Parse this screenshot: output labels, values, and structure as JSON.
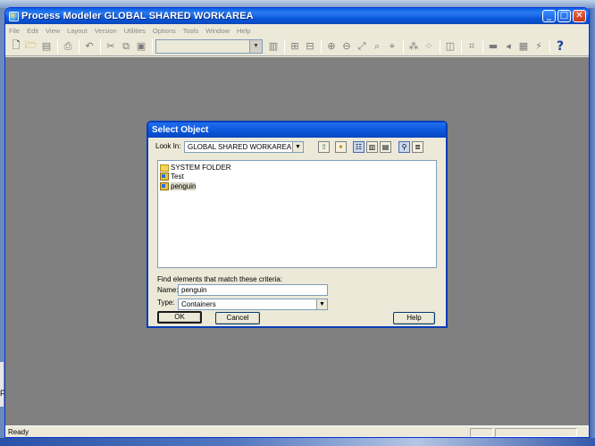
{
  "window": {
    "title": "Process Modeler GLOBAL SHARED WORKAREA",
    "minimize_glyph": "_",
    "maximize_glyph": "□",
    "close_glyph": "✕"
  },
  "menu": [
    "File",
    "Edit",
    "View",
    "Layout",
    "Version",
    "Utilities",
    "Options",
    "Tools",
    "Window",
    "Help"
  ],
  "toolbar": {
    "icons": [
      "new-icon",
      "open-icon",
      "save-icon",
      "print-icon",
      "undo-icon",
      "cut-icon",
      "copy-icon",
      "paste-icon",
      "zoom-in-icon",
      "zoom-out-icon",
      "zoom-fit-icon",
      "help-icon"
    ],
    "combo_value": "",
    "help_glyph": "?"
  },
  "status": {
    "text": "Ready"
  },
  "dialog": {
    "title": "Select Object",
    "look_in_label": "Look In:",
    "look_in_value": "GLOBAL SHARED WORKAREA",
    "items": [
      {
        "label": "SYSTEM FOLDER",
        "icon": "folder-icon",
        "selected": false
      },
      {
        "label": "Test",
        "icon": "container-icon",
        "selected": false
      },
      {
        "label": "penguin",
        "icon": "container-icon",
        "selected": true
      }
    ],
    "criteria_label": "Find elements that match these criteria:",
    "name_label": "Name:",
    "name_value": "penguin",
    "type_label": "Type:",
    "type_value": "Containers",
    "ok_label": "OK",
    "cancel_label": "Cancel",
    "help_label": "Help"
  }
}
